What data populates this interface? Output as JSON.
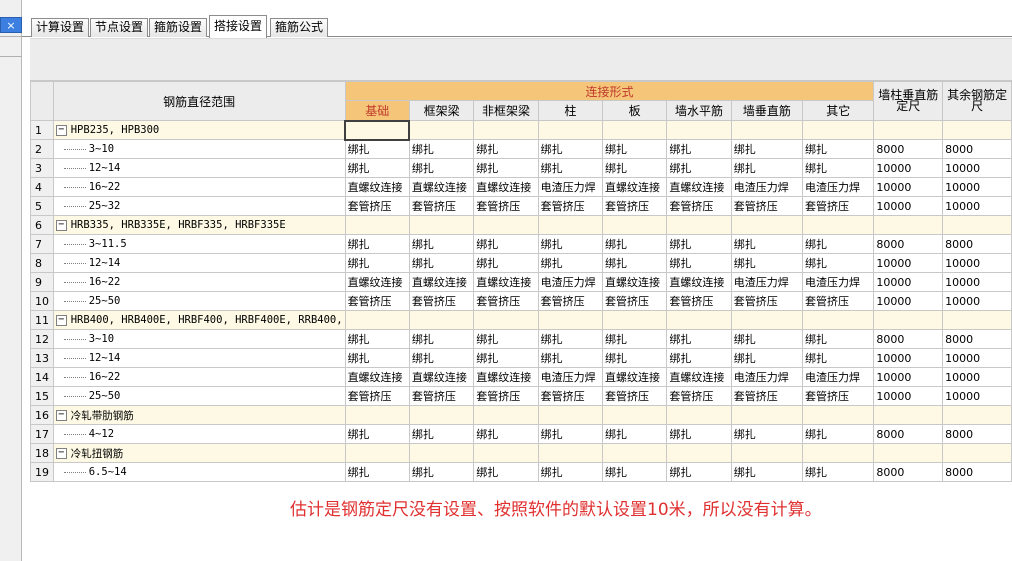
{
  "close_label": "×",
  "tabs": [
    {
      "label": "计算设置",
      "active": false
    },
    {
      "label": "节点设置",
      "active": false
    },
    {
      "label": "箍筋设置",
      "active": false
    },
    {
      "label": "搭接设置",
      "active": true
    },
    {
      "label": "箍筋公式",
      "active": false
    }
  ],
  "header": {
    "range": "钢筋直径范围",
    "group": "连接形式",
    "wall_col": "墙柱垂直筋定尺",
    "other": "其余钢筋定尺",
    "subs": [
      "基础",
      "框架梁",
      "非框架梁",
      "柱",
      "板",
      "墙水平筋",
      "墙垂直筋",
      "其它"
    ]
  },
  "rows": [
    {
      "n": "1",
      "type": "cat",
      "label": "HPB235, HPB300"
    },
    {
      "n": "2",
      "type": "item",
      "label": "3~10",
      "vals": [
        "绑扎",
        "绑扎",
        "绑扎",
        "绑扎",
        "绑扎",
        "绑扎",
        "绑扎",
        "绑扎",
        "8000",
        "8000"
      ]
    },
    {
      "n": "3",
      "type": "item",
      "label": "12~14",
      "vals": [
        "绑扎",
        "绑扎",
        "绑扎",
        "绑扎",
        "绑扎",
        "绑扎",
        "绑扎",
        "绑扎",
        "10000",
        "10000"
      ]
    },
    {
      "n": "4",
      "type": "item",
      "label": "16~22",
      "vals": [
        "直螺纹连接",
        "直螺纹连接",
        "直螺纹连接",
        "电渣压力焊",
        "直螺纹连接",
        "直螺纹连接",
        "电渣压力焊",
        "电渣压力焊",
        "10000",
        "10000"
      ]
    },
    {
      "n": "5",
      "type": "item",
      "label": "25~32",
      "vals": [
        "套管挤压",
        "套管挤压",
        "套管挤压",
        "套管挤压",
        "套管挤压",
        "套管挤压",
        "套管挤压",
        "套管挤压",
        "10000",
        "10000"
      ]
    },
    {
      "n": "6",
      "type": "cat",
      "label": "HRB335, HRB335E, HRBF335, HRBF335E"
    },
    {
      "n": "7",
      "type": "item",
      "label": "3~11.5",
      "vals": [
        "绑扎",
        "绑扎",
        "绑扎",
        "绑扎",
        "绑扎",
        "绑扎",
        "绑扎",
        "绑扎",
        "8000",
        "8000"
      ]
    },
    {
      "n": "8",
      "type": "item",
      "label": "12~14",
      "vals": [
        "绑扎",
        "绑扎",
        "绑扎",
        "绑扎",
        "绑扎",
        "绑扎",
        "绑扎",
        "绑扎",
        "10000",
        "10000"
      ]
    },
    {
      "n": "9",
      "type": "item",
      "label": "16~22",
      "vals": [
        "直螺纹连接",
        "直螺纹连接",
        "直螺纹连接",
        "电渣压力焊",
        "直螺纹连接",
        "直螺纹连接",
        "电渣压力焊",
        "电渣压力焊",
        "10000",
        "10000"
      ]
    },
    {
      "n": "10",
      "type": "item",
      "label": "25~50",
      "vals": [
        "套管挤压",
        "套管挤压",
        "套管挤压",
        "套管挤压",
        "套管挤压",
        "套管挤压",
        "套管挤压",
        "套管挤压",
        "10000",
        "10000"
      ]
    },
    {
      "n": "11",
      "type": "cat",
      "label": "HRB400, HRB400E, HRBF400, HRBF400E, RRB400,"
    },
    {
      "n": "12",
      "type": "item",
      "label": "3~10",
      "vals": [
        "绑扎",
        "绑扎",
        "绑扎",
        "绑扎",
        "绑扎",
        "绑扎",
        "绑扎",
        "绑扎",
        "8000",
        "8000"
      ]
    },
    {
      "n": "13",
      "type": "item",
      "label": "12~14",
      "vals": [
        "绑扎",
        "绑扎",
        "绑扎",
        "绑扎",
        "绑扎",
        "绑扎",
        "绑扎",
        "绑扎",
        "10000",
        "10000"
      ]
    },
    {
      "n": "14",
      "type": "item",
      "label": "16~22",
      "vals": [
        "直螺纹连接",
        "直螺纹连接",
        "直螺纹连接",
        "电渣压力焊",
        "直螺纹连接",
        "直螺纹连接",
        "电渣压力焊",
        "电渣压力焊",
        "10000",
        "10000"
      ]
    },
    {
      "n": "15",
      "type": "item",
      "label": "25~50",
      "vals": [
        "套管挤压",
        "套管挤压",
        "套管挤压",
        "套管挤压",
        "套管挤压",
        "套管挤压",
        "套管挤压",
        "套管挤压",
        "10000",
        "10000"
      ]
    },
    {
      "n": "16",
      "type": "cat",
      "label": "冷轧带肋钢筋"
    },
    {
      "n": "17",
      "type": "item",
      "label": "4~12",
      "vals": [
        "绑扎",
        "绑扎",
        "绑扎",
        "绑扎",
        "绑扎",
        "绑扎",
        "绑扎",
        "绑扎",
        "8000",
        "8000"
      ]
    },
    {
      "n": "18",
      "type": "cat",
      "label": "冷轧扭钢筋"
    },
    {
      "n": "19",
      "type": "item",
      "label": "6.5~14",
      "vals": [
        "绑扎",
        "绑扎",
        "绑扎",
        "绑扎",
        "绑扎",
        "绑扎",
        "绑扎",
        "绑扎",
        "8000",
        "8000"
      ]
    }
  ],
  "note": "估计是钢筋定尺没有设置、按照软件的默认设置10米，所以没有计算。"
}
